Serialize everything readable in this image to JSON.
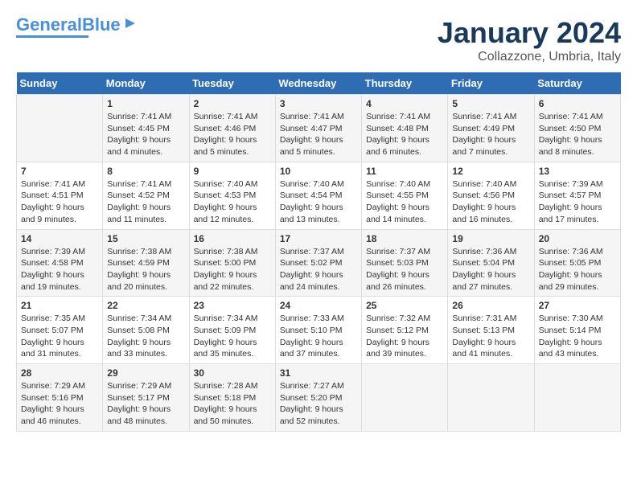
{
  "header": {
    "logo_general": "General",
    "logo_blue": "Blue",
    "month_year": "January 2024",
    "location": "Collazzone, Umbria, Italy"
  },
  "weekdays": [
    "Sunday",
    "Monday",
    "Tuesday",
    "Wednesday",
    "Thursday",
    "Friday",
    "Saturday"
  ],
  "weeks": [
    [
      {
        "day": "",
        "info": ""
      },
      {
        "day": "1",
        "info": "Sunrise: 7:41 AM\nSunset: 4:45 PM\nDaylight: 9 hours\nand 4 minutes."
      },
      {
        "day": "2",
        "info": "Sunrise: 7:41 AM\nSunset: 4:46 PM\nDaylight: 9 hours\nand 5 minutes."
      },
      {
        "day": "3",
        "info": "Sunrise: 7:41 AM\nSunset: 4:47 PM\nDaylight: 9 hours\nand 5 minutes."
      },
      {
        "day": "4",
        "info": "Sunrise: 7:41 AM\nSunset: 4:48 PM\nDaylight: 9 hours\nand 6 minutes."
      },
      {
        "day": "5",
        "info": "Sunrise: 7:41 AM\nSunset: 4:49 PM\nDaylight: 9 hours\nand 7 minutes."
      },
      {
        "day": "6",
        "info": "Sunrise: 7:41 AM\nSunset: 4:50 PM\nDaylight: 9 hours\nand 8 minutes."
      }
    ],
    [
      {
        "day": "7",
        "info": "Sunrise: 7:41 AM\nSunset: 4:51 PM\nDaylight: 9 hours\nand 9 minutes."
      },
      {
        "day": "8",
        "info": "Sunrise: 7:41 AM\nSunset: 4:52 PM\nDaylight: 9 hours\nand 11 minutes."
      },
      {
        "day": "9",
        "info": "Sunrise: 7:40 AM\nSunset: 4:53 PM\nDaylight: 9 hours\nand 12 minutes."
      },
      {
        "day": "10",
        "info": "Sunrise: 7:40 AM\nSunset: 4:54 PM\nDaylight: 9 hours\nand 13 minutes."
      },
      {
        "day": "11",
        "info": "Sunrise: 7:40 AM\nSunset: 4:55 PM\nDaylight: 9 hours\nand 14 minutes."
      },
      {
        "day": "12",
        "info": "Sunrise: 7:40 AM\nSunset: 4:56 PM\nDaylight: 9 hours\nand 16 minutes."
      },
      {
        "day": "13",
        "info": "Sunrise: 7:39 AM\nSunset: 4:57 PM\nDaylight: 9 hours\nand 17 minutes."
      }
    ],
    [
      {
        "day": "14",
        "info": "Sunrise: 7:39 AM\nSunset: 4:58 PM\nDaylight: 9 hours\nand 19 minutes."
      },
      {
        "day": "15",
        "info": "Sunrise: 7:38 AM\nSunset: 4:59 PM\nDaylight: 9 hours\nand 20 minutes."
      },
      {
        "day": "16",
        "info": "Sunrise: 7:38 AM\nSunset: 5:00 PM\nDaylight: 9 hours\nand 22 minutes."
      },
      {
        "day": "17",
        "info": "Sunrise: 7:37 AM\nSunset: 5:02 PM\nDaylight: 9 hours\nand 24 minutes."
      },
      {
        "day": "18",
        "info": "Sunrise: 7:37 AM\nSunset: 5:03 PM\nDaylight: 9 hours\nand 26 minutes."
      },
      {
        "day": "19",
        "info": "Sunrise: 7:36 AM\nSunset: 5:04 PM\nDaylight: 9 hours\nand 27 minutes."
      },
      {
        "day": "20",
        "info": "Sunrise: 7:36 AM\nSunset: 5:05 PM\nDaylight: 9 hours\nand 29 minutes."
      }
    ],
    [
      {
        "day": "21",
        "info": "Sunrise: 7:35 AM\nSunset: 5:07 PM\nDaylight: 9 hours\nand 31 minutes."
      },
      {
        "day": "22",
        "info": "Sunrise: 7:34 AM\nSunset: 5:08 PM\nDaylight: 9 hours\nand 33 minutes."
      },
      {
        "day": "23",
        "info": "Sunrise: 7:34 AM\nSunset: 5:09 PM\nDaylight: 9 hours\nand 35 minutes."
      },
      {
        "day": "24",
        "info": "Sunrise: 7:33 AM\nSunset: 5:10 PM\nDaylight: 9 hours\nand 37 minutes."
      },
      {
        "day": "25",
        "info": "Sunrise: 7:32 AM\nSunset: 5:12 PM\nDaylight: 9 hours\nand 39 minutes."
      },
      {
        "day": "26",
        "info": "Sunrise: 7:31 AM\nSunset: 5:13 PM\nDaylight: 9 hours\nand 41 minutes."
      },
      {
        "day": "27",
        "info": "Sunrise: 7:30 AM\nSunset: 5:14 PM\nDaylight: 9 hours\nand 43 minutes."
      }
    ],
    [
      {
        "day": "28",
        "info": "Sunrise: 7:29 AM\nSunset: 5:16 PM\nDaylight: 9 hours\nand 46 minutes."
      },
      {
        "day": "29",
        "info": "Sunrise: 7:29 AM\nSunset: 5:17 PM\nDaylight: 9 hours\nand 48 minutes."
      },
      {
        "day": "30",
        "info": "Sunrise: 7:28 AM\nSunset: 5:18 PM\nDaylight: 9 hours\nand 50 minutes."
      },
      {
        "day": "31",
        "info": "Sunrise: 7:27 AM\nSunset: 5:20 PM\nDaylight: 9 hours\nand 52 minutes."
      },
      {
        "day": "",
        "info": ""
      },
      {
        "day": "",
        "info": ""
      },
      {
        "day": "",
        "info": ""
      }
    ]
  ]
}
